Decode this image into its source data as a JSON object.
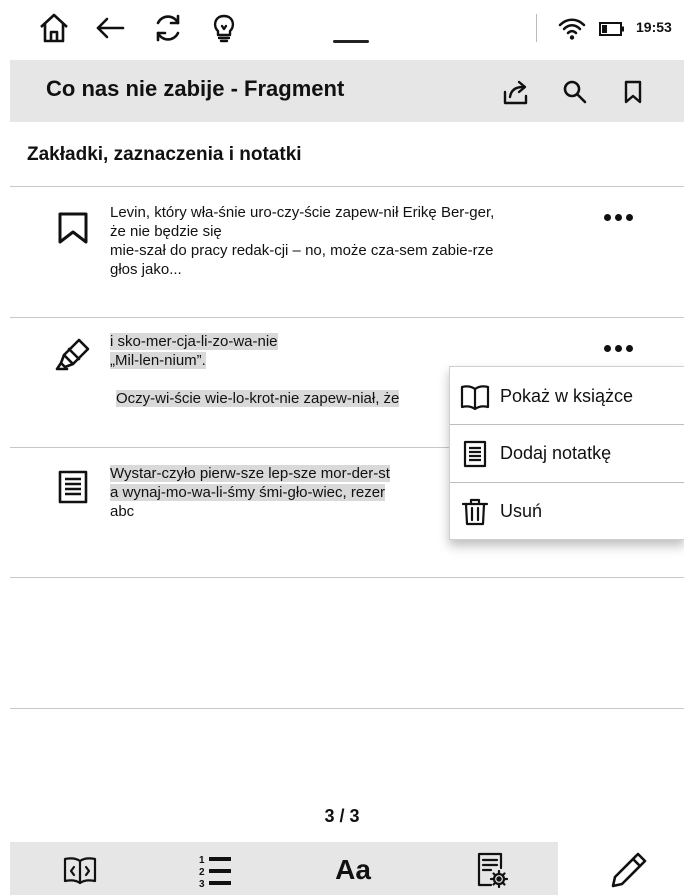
{
  "status_bar": {
    "time": "19:53",
    "icons": [
      "home-icon",
      "back-arrow-icon",
      "sync-icon",
      "lightbulb-icon",
      "wifi-icon",
      "battery-icon"
    ]
  },
  "header": {
    "title": "Co nas nie zabije - Fragment",
    "actions": [
      "share-icon",
      "search-icon",
      "bookmark-icon"
    ]
  },
  "section": {
    "title": "Zakładki, zaznaczenia i notatki"
  },
  "items": [
    {
      "type": "bookmark",
      "icon": "bookmark-icon",
      "lines": [
        "Levin, który wła-śnie uro-czy-ście zapew-nił Erikę Ber-ger,",
        "że nie będzie się",
        "mie-szał do pracy redak-cji – no, może cza-sem zabie-rze",
        "głos jako..."
      ]
    },
    {
      "type": "highlight",
      "icon": "highlighter-icon",
      "lines": [
        "i sko-mer-cja-li-zo-wa-nie",
        "„Mil-len-nium”.",
        "Oczy-wi-ście wie-lo-krot-nie zapew-niał, że"
      ]
    },
    {
      "type": "note",
      "icon": "note-icon",
      "lines": [
        "Wystar-czyło pierw-sze lep-sze mor-der-st",
        "a wynaj-mo-wa-li-śmy śmi-gło-wiec, rezer",
        "abc"
      ]
    }
  ],
  "context_menu": {
    "items": [
      {
        "label": "Pokaż w książce",
        "icon": "open-book-icon"
      },
      {
        "label": "Dodaj notatkę",
        "icon": "note-icon"
      },
      {
        "label": "Usuń",
        "icon": "trash-icon"
      }
    ]
  },
  "pager": {
    "text": "3 / 3"
  },
  "toolbar": {
    "font_label": "Aa",
    "icons": [
      "book-code-icon",
      "numbered-list-icon",
      "font-icon",
      "document-settings-icon",
      "pencil-icon"
    ]
  }
}
